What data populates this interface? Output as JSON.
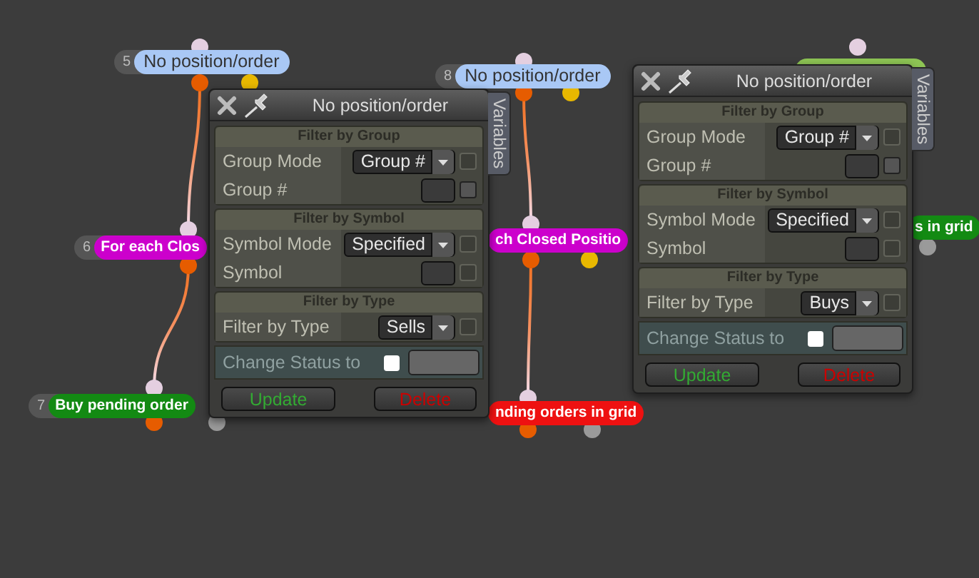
{
  "nodes": [
    {
      "number": "5",
      "label": "No position/order",
      "color": "#a9c8f5"
    },
    {
      "number": "8",
      "label": "No position/order",
      "color": "#a9c8f5"
    },
    {
      "number": "6",
      "label": "For each Clos",
      "color": "#cc00cc"
    },
    {
      "label": "ch Closed Positio",
      "color": "#cc00cc"
    },
    {
      "number": "7",
      "label": "Buy pending order",
      "color": "#138a13"
    },
    {
      "label": "nding orders in grid",
      "color": "#ee1111"
    },
    {
      "color": "#8dc454"
    },
    {
      "label": "s in grid",
      "color": "#138a13"
    }
  ],
  "dialogs": [
    {
      "title": "No position/order",
      "side_tab": "Variables",
      "sections": [
        {
          "title": "Filter by Group",
          "rows": [
            {
              "kind": "dropdown",
              "label": "Group Mode",
              "value": "Group #",
              "checkbox_enabled": false
            },
            {
              "kind": "input",
              "label": "Group #",
              "checkbox_enabled": true
            }
          ]
        },
        {
          "title": "Filter by Symbol",
          "rows": [
            {
              "kind": "dropdown",
              "label": "Symbol Mode",
              "value": "Specified",
              "checkbox_enabled": false
            },
            {
              "kind": "input",
              "label": "Symbol",
              "checkbox_enabled": false
            }
          ]
        },
        {
          "title": "Filter by Type",
          "rows": [
            {
              "kind": "dropdown",
              "label": "Filter by Type",
              "value": "Sells",
              "checkbox_enabled": false
            }
          ]
        }
      ],
      "change_status": {
        "label": "Change Status to",
        "checked": false
      },
      "buttons": [
        {
          "kind": "update",
          "label": "Update"
        },
        {
          "kind": "delete",
          "label": "Delete"
        }
      ]
    },
    {
      "title": "No position/order",
      "side_tab": "Variables",
      "sections": [
        {
          "title": "Filter by Group",
          "rows": [
            {
              "kind": "dropdown",
              "label": "Group Mode",
              "value": "Group #",
              "checkbox_enabled": false
            },
            {
              "kind": "input",
              "label": "Group #",
              "checkbox_enabled": true
            }
          ]
        },
        {
          "title": "Filter by Symbol",
          "rows": [
            {
              "kind": "dropdown",
              "label": "Symbol Mode",
              "value": "Specified",
              "checkbox_enabled": false
            },
            {
              "kind": "input",
              "label": "Symbol",
              "checkbox_enabled": false
            }
          ]
        },
        {
          "title": "Filter by Type",
          "rows": [
            {
              "kind": "dropdown",
              "label": "Filter by Type",
              "value": "Buys",
              "checkbox_enabled": false
            }
          ]
        }
      ],
      "change_status": {
        "label": "Change Status to",
        "checked": false
      },
      "buttons": [
        {
          "kind": "update",
          "label": "Update"
        },
        {
          "kind": "delete",
          "label": "Delete"
        }
      ]
    }
  ]
}
